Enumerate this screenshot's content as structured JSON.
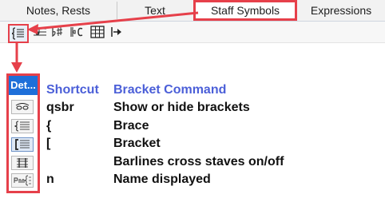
{
  "tabs": [
    {
      "label": "Notes, Rests"
    },
    {
      "label": "Text"
    },
    {
      "label": "Staff Symbols"
    },
    {
      "label": "Expressions"
    }
  ],
  "toolbar": {
    "icons": [
      "bracket-icon",
      "staff-lines-icon",
      "key-signature-icon",
      "clef-time-icon",
      "grid-icon",
      "arrow-right-icon"
    ]
  },
  "panel": {
    "title": "Det...",
    "icons": [
      "slur-icon",
      "brace-icon",
      "bracket-icon",
      "barline-icon",
      "name-icon"
    ],
    "selected_index": 2
  },
  "table": {
    "col_shortcut": "Shortcut",
    "col_command": "Bracket Command",
    "rows": [
      {
        "shortcut": "qsbr",
        "command": "Show or hide brackets"
      },
      {
        "shortcut": "{",
        "command": "Brace"
      },
      {
        "shortcut": "[",
        "command": "Bracket"
      },
      {
        "shortcut": "",
        "command": "Barlines cross staves on/off"
      },
      {
        "shortcut": "n",
        "command": "Name displayed"
      }
    ]
  },
  "colors": {
    "highlight": "#e6404a",
    "header_text": "#4b5fd8",
    "panel_title_bg": "#1e6fd9"
  }
}
